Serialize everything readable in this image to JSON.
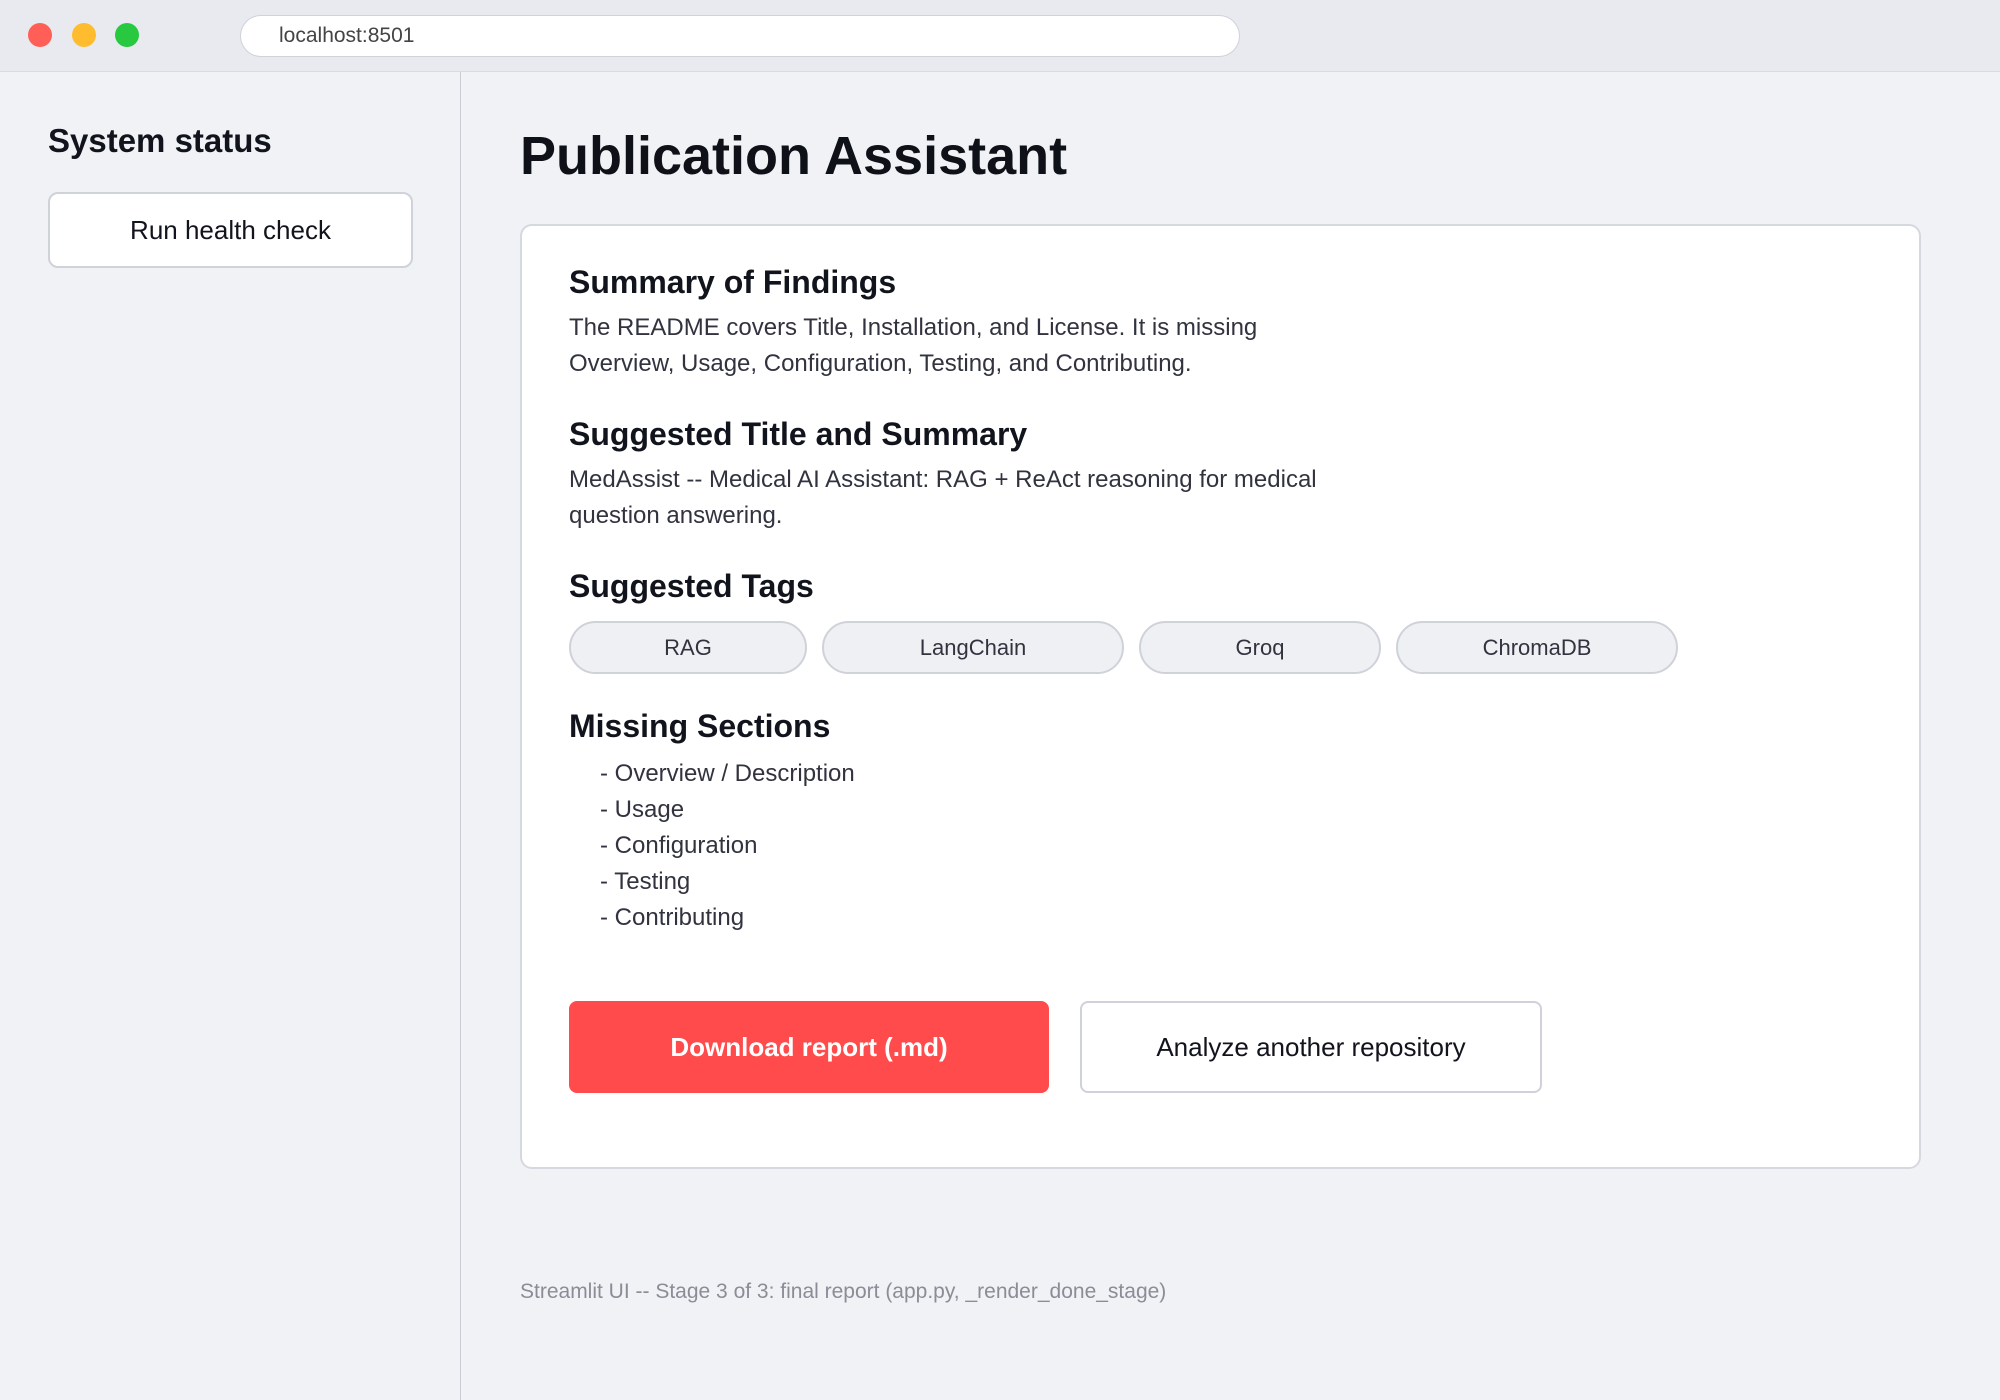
{
  "browser": {
    "url": "localhost:8501"
  },
  "sidebar": {
    "title": "System status",
    "health_button": "Run health check"
  },
  "main": {
    "title": "Publication Assistant",
    "report": {
      "summary_heading": "Summary of Findings",
      "summary_text": "The README covers Title, Installation, and License. It is missing Overview, Usage, Configuration, Testing, and Contributing.",
      "title_heading": "Suggested Title and Summary",
      "title_text": "MedAssist -- Medical AI Assistant: RAG + ReAct reasoning for medical question answering.",
      "tags_heading": "Suggested Tags",
      "tags": [
        "RAG",
        "LangChain",
        "Groq",
        "ChromaDB"
      ],
      "missing_heading": "Missing Sections",
      "missing_sections": [
        "- Overview / Description",
        "- Usage",
        "- Configuration",
        "- Testing",
        "- Contributing"
      ]
    },
    "download_button": "Download report (.md)",
    "analyze_button": "Analyze another repository"
  },
  "footer": {
    "note": "Streamlit UI -- Stage 3 of 3: final report (app.py, _render_done_stage)"
  },
  "colors": {
    "primary": "#ff4b4b",
    "background": "#f0f2f6"
  }
}
